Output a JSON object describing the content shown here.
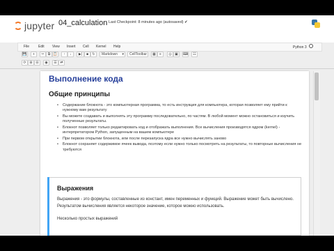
{
  "header": {
    "logo_text": "jupyter",
    "notebook_title": "04_calculation",
    "checkpoint": "Last Checkpoint: 8 minutes ago (autosaved)",
    "checkmark": "✔"
  },
  "menubar": {
    "items": [
      "File",
      "Edit",
      "View",
      "Insert",
      "Cell",
      "Kernel",
      "Help"
    ],
    "kernel_name": "Python 3",
    "kernel_status_icon": "circle-icon"
  },
  "toolbar": {
    "row1": [
      "💾",
      "+",
      "✂",
      "⧉",
      "📋",
      "↑",
      "↓",
      "▶|",
      "■",
      "↻"
    ],
    "cell_type": "Markdown",
    "cell_toolbar": "CellToolbar",
    "row2": [
      "⟳",
      "⊞",
      "⊟",
      "◉",
      "☰",
      "⇄"
    ]
  },
  "notebook": {
    "h1": "Выполнение кода",
    "h2": "Общие принципы",
    "bullets": [
      "Содержание блокнота - это компьютерная программа, то есть инструкция для компьютера, которая позволяет ему прийти к нужному вам результату",
      "Вы можете создавать и выполнять эту программу последовательно, по частям. В любой момент можно остановиться и изучить полученные результаты.",
      "Блокнот позволяет только редактировать код и отображать выполнения. Все вычисления производятся ядром (kernel) - интерпретатором Python, запущенным на вашем компьютере",
      "При первом открытии блокнота, или после перезапуска ядра все нужно вычислять заново",
      "Блокнот сохраняет содержимое ячеек вывода, поэтому если нужно только посмотреть на результаты, то повторные вычисления не требуются"
    ],
    "cell2": {
      "h3": "Выражения",
      "p1": "Выражения - это формулы, составленные из констант, имен переменных и функций. Выражение может быть вычислено. Результатом вычисления является некоторое значение, которое можно использовать.",
      "p2": "Несколько простых выражений"
    }
  }
}
